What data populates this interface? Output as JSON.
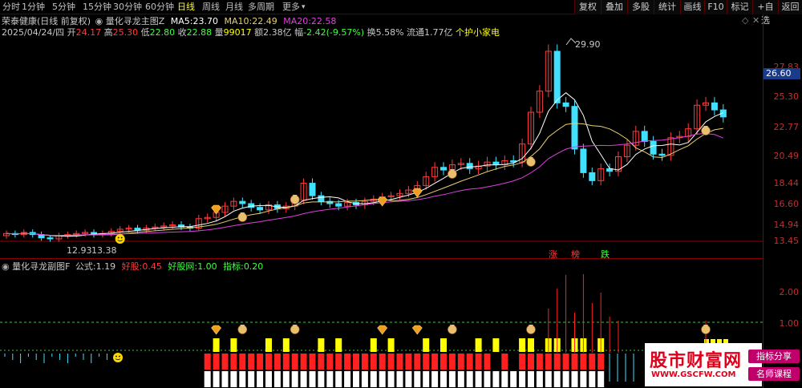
{
  "periods": [
    {
      "label": "分时",
      "active": false
    },
    {
      "label": "1分钟",
      "active": false
    },
    {
      "label": "5分钟",
      "active": false
    },
    {
      "label": "15分钟",
      "active": false
    },
    {
      "label": "30分钟",
      "active": false
    },
    {
      "label": "60分钟",
      "active": false
    },
    {
      "label": "日线",
      "active": true
    },
    {
      "label": "周线",
      "active": false
    },
    {
      "label": "月线",
      "active": false
    },
    {
      "label": "多周期",
      "active": false
    },
    {
      "label": "更多",
      "active": false
    }
  ],
  "tools": [
    "复权",
    "叠加",
    "多股",
    "统计",
    "画线",
    "F10",
    "标记",
    "+自选",
    "返回"
  ],
  "main": {
    "stock": "荣泰健康(日线 前复权)",
    "formula": "量化寻龙主图Z",
    "ma5_label": "MA5:",
    "ma5": "23.70",
    "ma10_label": "MA10:",
    "ma10": "22.49",
    "ma20_label": "MA20:",
    "ma20": "22.58",
    "date": "2025/04/24/四",
    "open_label": "开",
    "open": "24.17",
    "high_label": "高",
    "high": "25.30",
    "low_label": "低",
    "low": "22.80",
    "close_label": "收",
    "close": "22.88",
    "vol_label": "量",
    "vol": "99017",
    "amt_label": "额",
    "amt": "2.38亿",
    "chg_label": "幅",
    "chg": "-2.42(-9.57%)",
    "turn_label": "换",
    "turn": "5.58%",
    "float_label": "流通",
    "float": "1.77亿",
    "tag": "个护小家电",
    "peak_label": "29.90",
    "low_mark": "13.38",
    "low_mark2": "12.93",
    "zhang": "涨",
    "bang": "榜",
    "die": "跌"
  },
  "price_tag": "26.60",
  "price_axis": [
    "27.83",
    "25.30",
    "22.77",
    "20.49",
    "18.44",
    "16.60",
    "14.94",
    "13.45"
  ],
  "sub": {
    "formula": "量化寻龙副图F",
    "gongshi_label": "公式:",
    "gongshi": "1.19",
    "haogu_label": "好股:",
    "haogu": "0.45",
    "haogu2_label": "好股网:",
    "haogu2": "1.00",
    "zhibiao_label": "指标:",
    "zhibiao": "0.20"
  },
  "sub_axis": [
    "2.00",
    "1.00"
  ],
  "watermark": {
    "brand": "股市财富网",
    "url": "WWW.GSCFW.COM",
    "tag1": "指标分享",
    "tag2": "名师课程"
  },
  "colors": {
    "up": "#ff3b3b",
    "down": "#40e0ff",
    "ma5": "#ffffff",
    "ma10": "#e8d070",
    "ma20": "#e040e0"
  }
}
